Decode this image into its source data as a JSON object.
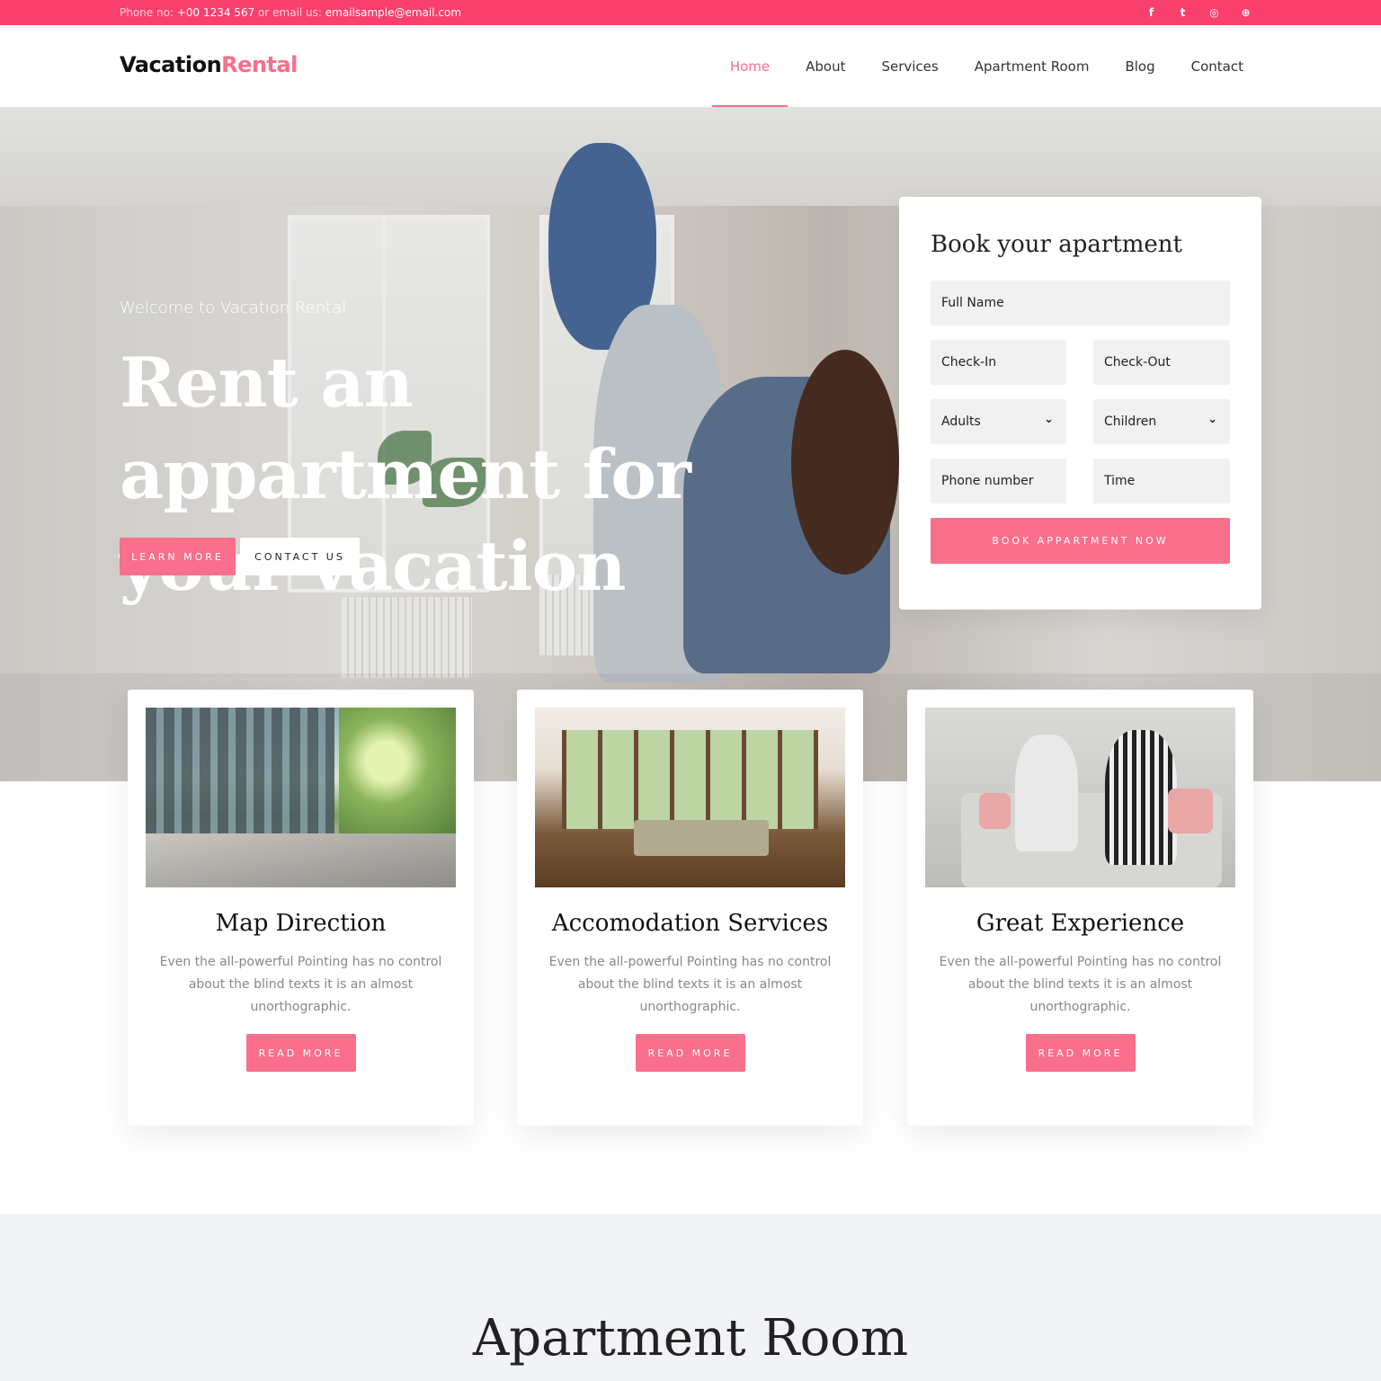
{
  "topbar": {
    "phone_label": "Phone no:",
    "phone": "+00 1234 567",
    "email_label": "or email us:",
    "email": "emailsample@email.com",
    "socials": [
      {
        "name": "facebook-icon",
        "glyph": "f"
      },
      {
        "name": "twitter-icon",
        "glyph": "t"
      },
      {
        "name": "instagram-icon",
        "glyph": "◎"
      },
      {
        "name": "dribbble-icon",
        "glyph": "⊕"
      }
    ],
    "color": "#f9406d"
  },
  "brand": {
    "part1": "Vacation",
    "part2": "Rental",
    "accent": "#f96f8c"
  },
  "nav": [
    {
      "label": "Home",
      "active": true
    },
    {
      "label": "About",
      "active": false
    },
    {
      "label": "Services",
      "active": false
    },
    {
      "label": "Apartment Room",
      "active": false
    },
    {
      "label": "Blog",
      "active": false
    },
    {
      "label": "Contact",
      "active": false
    }
  ],
  "hero": {
    "welcome": "Welcome to Vacation Rental",
    "headline": "Rent an appartment for your vacation",
    "learn_more": "LEARN MORE",
    "contact_us": "CONTACT US"
  },
  "booking": {
    "title": "Book your apartment",
    "full_name": "Full Name",
    "check_in": "Check-In",
    "check_out": "Check-Out",
    "adults": "Adults",
    "children": "Children",
    "phone": "Phone number",
    "time": "Time",
    "submit": "BOOK APPARTMENT NOW"
  },
  "services": [
    {
      "title": "Map Direction",
      "desc": "Even the all-powerful Pointing has no control about the blind texts it is an almost unorthographic.",
      "button": "READ MORE"
    },
    {
      "title": "Accomodation Services",
      "desc": "Even the all-powerful Pointing has no control about the blind texts it is an almost unorthographic.",
      "button": "READ MORE"
    },
    {
      "title": "Great Experience",
      "desc": "Even the all-powerful Pointing has no control about the blind texts it is an almost unorthographic.",
      "button": "READ MORE"
    }
  ],
  "apartment_section": {
    "heading": "Apartment Room"
  }
}
